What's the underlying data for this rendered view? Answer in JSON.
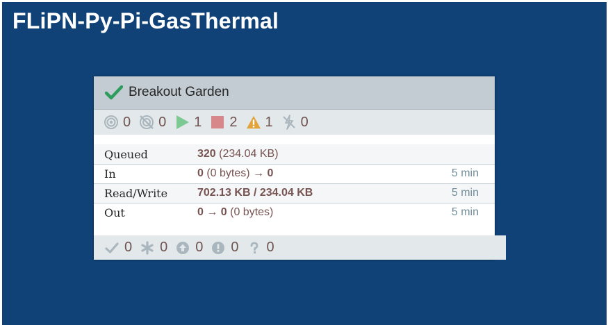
{
  "process_group": {
    "title": "FLiPN-Py-Pi-GasThermal",
    "card": {
      "name": "Breakout Garden",
      "status_icon": "checkmark-icon",
      "accent_color": "#2e9c5c",
      "counts": {
        "transmitting": "0",
        "not_transmitting": "0",
        "running": "1",
        "stopped": "2",
        "invalid": "1",
        "disabled": "0"
      },
      "rows": [
        {
          "label": "Queued",
          "value_bold": "320",
          "value_rest": " (234.04 KB)",
          "time": ""
        },
        {
          "label": "In",
          "value_bold": "0",
          "value_rest": " (0 bytes) → ",
          "value_tail": "0",
          "time": "5 min"
        },
        {
          "label": "Read/Write",
          "value_bold": "702.13 KB / 234.04 KB",
          "value_rest": "",
          "time": "5 min"
        },
        {
          "label": "Out",
          "value_bold": "0 → 0",
          "value_rest": " (0 bytes)",
          "time": "5 min"
        }
      ],
      "versioning": {
        "up_to_date": "0",
        "locally_modified": "0",
        "stale": "0",
        "modified_and_stale": "0",
        "sync_failure": "0"
      }
    }
  }
}
